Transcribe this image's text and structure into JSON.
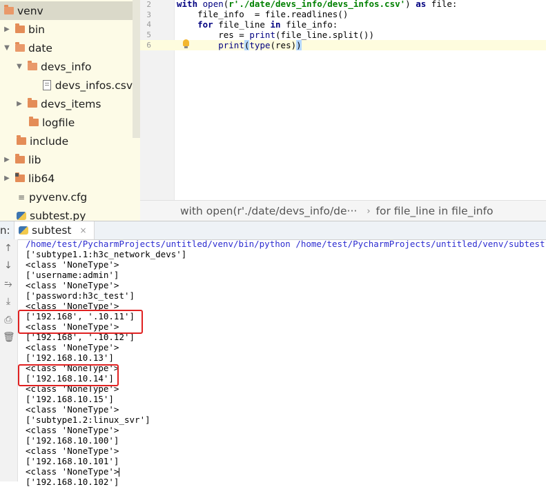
{
  "tree": {
    "items": [
      {
        "label": "venv",
        "icon": "folder-open-icon",
        "arrow": "",
        "indent": 0
      },
      {
        "label": "bin",
        "icon": "folder-icon",
        "arrow": "▶",
        "indent": 1
      },
      {
        "label": "date",
        "icon": "folder-open-icon",
        "arrow": "▼",
        "indent": 1
      },
      {
        "label": "devs_info",
        "icon": "folder-open-icon",
        "arrow": "▼",
        "indent": 2
      },
      {
        "label": "devs_infos.csv",
        "icon": "text-file-icon",
        "arrow": "",
        "indent": 3
      },
      {
        "label": "devs_items",
        "icon": "folder-icon",
        "arrow": "▶",
        "indent": 2
      },
      {
        "label": "logfile",
        "icon": "folder-icon",
        "arrow": "",
        "indent": 2
      },
      {
        "label": "include",
        "icon": "folder-icon",
        "arrow": "",
        "indent": 1
      },
      {
        "label": "lib",
        "icon": "folder-icon",
        "arrow": "▶",
        "indent": 1
      },
      {
        "label": "lib64",
        "icon": "folder-link-icon",
        "arrow": "▶",
        "indent": 1
      },
      {
        "label": "pyvenv.cfg",
        "icon": "config-file-icon",
        "arrow": "",
        "indent": 1
      },
      {
        "label": "subtest.py",
        "icon": "python-file-icon",
        "arrow": "",
        "indent": 1
      }
    ]
  },
  "editor": {
    "line_numbers": [
      "2",
      "3",
      "4",
      "5",
      "6"
    ],
    "l2": {
      "kw1": "with",
      "sp1": " ",
      "fn1": "open",
      "p1": "(",
      "str": "r'./date/devs_info/devs_infos.csv'",
      "p2": ") ",
      "kw2": "as",
      "rest": " file:"
    },
    "l3": {
      "text": "    file_info  = file.readlines()"
    },
    "l4": {
      "pre": "    ",
      "kw1": "for",
      "mid": " file_line ",
      "kw2": "in",
      "rest": " file_info:"
    },
    "l5": {
      "pre": "        res = ",
      "fn": "print",
      "rest": "(file_line.split())"
    },
    "l6": {
      "pre": "        ",
      "fn1": "print",
      "p1": "(",
      "fn2": "type",
      "mid": "(res)",
      "p2": ")"
    }
  },
  "breadcrumb": {
    "first": "with open(r'./date/devs_info/de···",
    "separator": "›",
    "second": "for file_line in file_info"
  },
  "run": {
    "label": "n:",
    "tab_label": "subtest",
    "tab_close": "×",
    "console": [
      "/home/test/PycharmProjects/untitled/venv/bin/python /home/test/PycharmProjects/untitled/venv/subtest.py",
      "['subtype1.1:h3c_network_devs']",
      "<class 'NoneType'>",
      "['username:admin']",
      "<class 'NoneType'>",
      "['password:h3c_test']",
      "<class 'NoneType'>",
      "['192.168', '.10.11']",
      "<class 'NoneType'>",
      "['192.168', '.10.12']",
      "<class 'NoneType'>",
      "['192.168.10.13']",
      "<class 'NoneType'>",
      "['192.168.10.14']",
      "<class 'NoneType'>",
      "['192.168.10.15']",
      "<class 'NoneType'>",
      "['subtype1.2:linux_svr']",
      "<class 'NoneType'>",
      "['192.168.10.100']",
      "<class 'NoneType'>",
      "['192.168.10.101']",
      "<class 'NoneType'>",
      "['192.168.10.102']"
    ]
  },
  "colors": {
    "highlight_box": "#e02020",
    "tree_background": "#fdfbe7",
    "keyword": "#000080",
    "string": "#008000"
  }
}
